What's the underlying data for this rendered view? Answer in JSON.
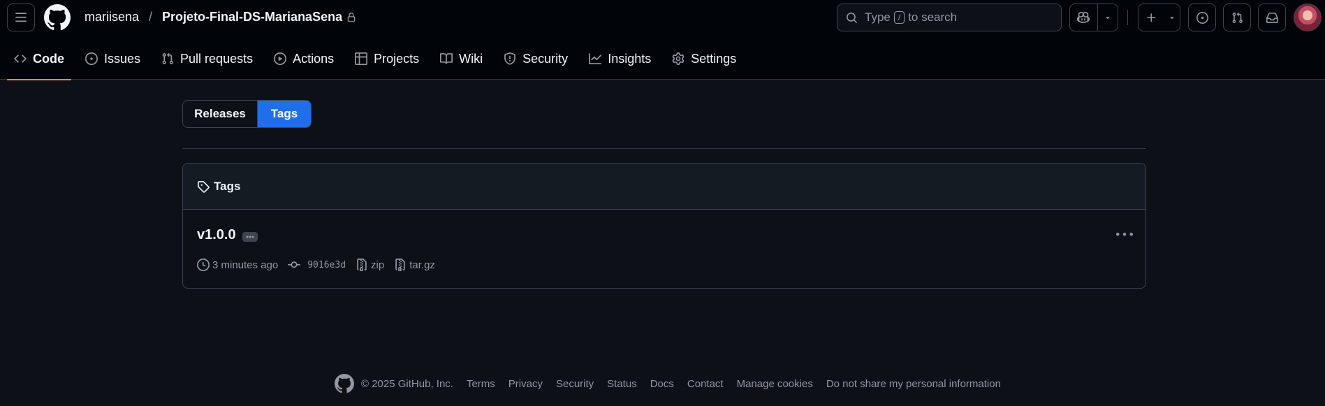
{
  "header": {
    "owner": "mariisena",
    "separator": "/",
    "repo": "Projeto-Final-DS-MarianaSena",
    "search": {
      "prefix": "Type",
      "key": "/",
      "suffix": "to search"
    }
  },
  "nav_tabs": [
    {
      "label": "Code",
      "icon": "code-icon",
      "active": true
    },
    {
      "label": "Issues",
      "icon": "issue-icon"
    },
    {
      "label": "Pull requests",
      "icon": "pull-request-icon"
    },
    {
      "label": "Actions",
      "icon": "play-icon"
    },
    {
      "label": "Projects",
      "icon": "table-icon"
    },
    {
      "label": "Wiki",
      "icon": "book-icon"
    },
    {
      "label": "Security",
      "icon": "shield-icon"
    },
    {
      "label": "Insights",
      "icon": "graph-icon"
    },
    {
      "label": "Settings",
      "icon": "gear-icon"
    }
  ],
  "subnav": {
    "releases": "Releases",
    "tags": "Tags"
  },
  "tags_box": {
    "heading": "Tags",
    "tag": {
      "name": "v1.0.0",
      "time": "3 minutes ago",
      "commit": "9016e3d",
      "zip": "zip",
      "targz": "tar.gz"
    }
  },
  "footer": {
    "copyright": "© 2025 GitHub, Inc.",
    "links": [
      "Terms",
      "Privacy",
      "Security",
      "Status",
      "Docs",
      "Contact",
      "Manage cookies",
      "Do not share my personal information"
    ]
  },
  "colors": {
    "accent": "#1f6feb",
    "active_underline": "#f78166",
    "background": "#0d1117",
    "header_bg": "#010409"
  }
}
